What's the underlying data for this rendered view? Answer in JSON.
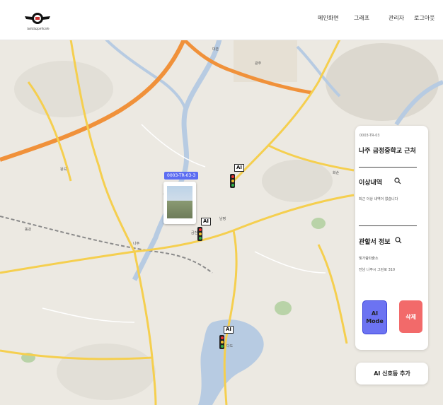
{
  "header": {
    "logo_text": "boltdazpmfcafe",
    "nav": [
      {
        "label": "메인화면"
      },
      {
        "label": "그래프"
      },
      {
        "label": "관리자"
      },
      {
        "label": "로그아웃"
      }
    ]
  },
  "map": {
    "camera_tag": "0003-TR-03-3",
    "ai_badge": "AI",
    "labels": [
      "나주",
      "광주",
      "대촌",
      "남평",
      "다도",
      "금천",
      "산포",
      "동강",
      "왕곡",
      "화순"
    ]
  },
  "panel": {
    "code": "0003-TR-03",
    "title": "나주 금정중학교 근처",
    "anomaly_heading": "이상내역",
    "anomaly_text": "최근 이상 내역이 없습니다",
    "office_heading": "관할서 정보",
    "office_name": "빛가람파출소",
    "office_address": "전남 나주시 그린로 310",
    "ai_mode_line1": "AI",
    "ai_mode_line2": "Mode",
    "delete_label": "삭제"
  },
  "add_button_label": "AI 신호등 추가",
  "colors": {
    "accent": "#5c6df2",
    "ai_button": "#6c73f2",
    "delete_button": "#f26a6a",
    "highway": "#f0913a",
    "road": "#f5cf4f",
    "water": "#b7cbe2",
    "map_bg": "#ece9e2"
  }
}
